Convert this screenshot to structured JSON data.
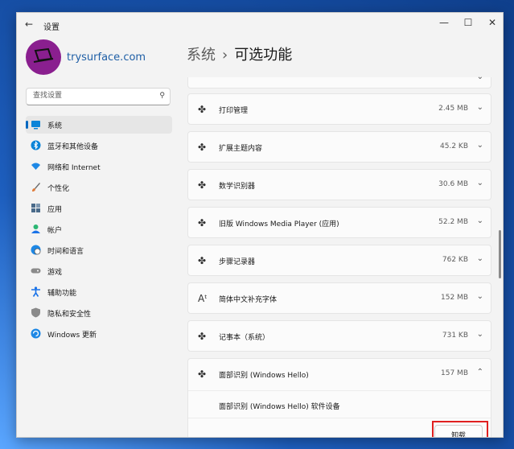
{
  "window": {
    "title": "设置",
    "back_icon": "back-arrow-icon",
    "controls": {
      "minimize": "—",
      "maximize": "☐",
      "close": "✕"
    }
  },
  "profile": {
    "name": "trysurface.com"
  },
  "search": {
    "placeholder": "查找设置",
    "icon": "search-icon"
  },
  "nav": {
    "items": [
      {
        "label": "系统",
        "icon": "system-icon",
        "color": "#0067c0",
        "active": true
      },
      {
        "label": "蓝牙和其他设备",
        "icon": "bluetooth-icon",
        "color": "#0a84d8"
      },
      {
        "label": "网络和 Internet",
        "icon": "wifi-icon",
        "color": "#1e88e5"
      },
      {
        "label": "个性化",
        "icon": "brush-icon",
        "color": "#e07b39"
      },
      {
        "label": "应用",
        "icon": "apps-icon",
        "color": "#4a6b8a"
      },
      {
        "label": "帐户",
        "icon": "account-icon",
        "color": "#2bb673"
      },
      {
        "label": "时间和语言",
        "icon": "globe-clock-icon",
        "color": "#1e88e5"
      },
      {
        "label": "游戏",
        "icon": "gamepad-icon",
        "color": "#7a7a7a"
      },
      {
        "label": "辅助功能",
        "icon": "accessibility-icon",
        "color": "#1a73e8"
      },
      {
        "label": "隐私和安全性",
        "icon": "shield-icon",
        "color": "#6b6b6b"
      },
      {
        "label": "Windows 更新",
        "icon": "update-icon",
        "color": "#1e88e5"
      }
    ]
  },
  "header": {
    "parent": "系统",
    "separator": "›",
    "title": "可选功能"
  },
  "features": [
    {
      "label": "打印管理",
      "size": "2.45 MB",
      "icon": "puzzle-icon"
    },
    {
      "label": "扩展主题内容",
      "size": "45.2 KB",
      "icon": "puzzle-icon"
    },
    {
      "label": "数学识别器",
      "size": "30.6 MB",
      "icon": "puzzle-icon"
    },
    {
      "label": "旧版 Windows Media Player (应用)",
      "size": "52.2 MB",
      "icon": "puzzle-icon"
    },
    {
      "label": "步骤记录器",
      "size": "762 KB",
      "icon": "puzzle-icon"
    },
    {
      "label": "简体中文补充字体",
      "size": "152 MB",
      "icon": "font-icon"
    },
    {
      "label": "记事本（系统）",
      "size": "731 KB",
      "icon": "puzzle-icon"
    }
  ],
  "expanded": {
    "label": "面部识别 (Windows Hello)",
    "size": "157 MB",
    "detail": "面部识别 (Windows Hello) 软件设备",
    "uninstall_label": "卸载"
  }
}
